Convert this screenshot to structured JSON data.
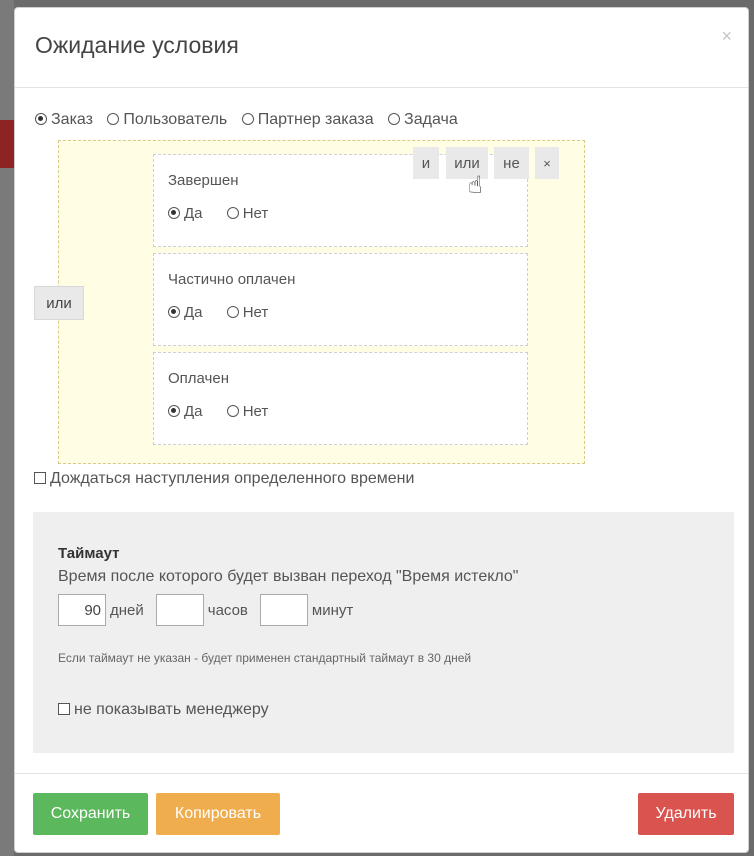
{
  "dialog": {
    "title": "Ожидание условия",
    "close_label": "×"
  },
  "scope": {
    "selected": "Заказ",
    "options": [
      "Заказ",
      "Пользователь",
      "Партнер заказа",
      "Задача"
    ]
  },
  "conditions": {
    "group_operator_label": "или",
    "toolbar": {
      "and_label": "и",
      "or_label": "или",
      "not_label": "не",
      "remove_label": "×"
    },
    "yes_label": "Да",
    "no_label": "Нет",
    "items": [
      {
        "title": "Завершен",
        "value": "Да"
      },
      {
        "title": "Частично оплачен",
        "value": "Да"
      },
      {
        "title": "Оплачен",
        "value": "Да"
      }
    ]
  },
  "wait_time": {
    "label": "Дождаться наступления определенного времени",
    "checked": false
  },
  "timeout": {
    "title": "Таймаут",
    "description": "Время после которого будет вызван переход \"Время истекло\"",
    "days_value": "90",
    "days_unit": "дней",
    "hours_value": "",
    "hours_unit": "часов",
    "minutes_value": "",
    "minutes_unit": "минут",
    "note": "Если таймаут не указан - будет применен стандартный таймаут в 30 дней",
    "hide_manager_label": "не показывать менеджеру",
    "hide_manager_checked": false
  },
  "footer": {
    "save_label": "Сохранить",
    "copy_label": "Копировать",
    "delete_label": "Удалить"
  },
  "colors": {
    "save": "#5cb85c",
    "copy": "#f0ad4e",
    "delete": "#d9534f",
    "condition_area": "#fffde3"
  }
}
